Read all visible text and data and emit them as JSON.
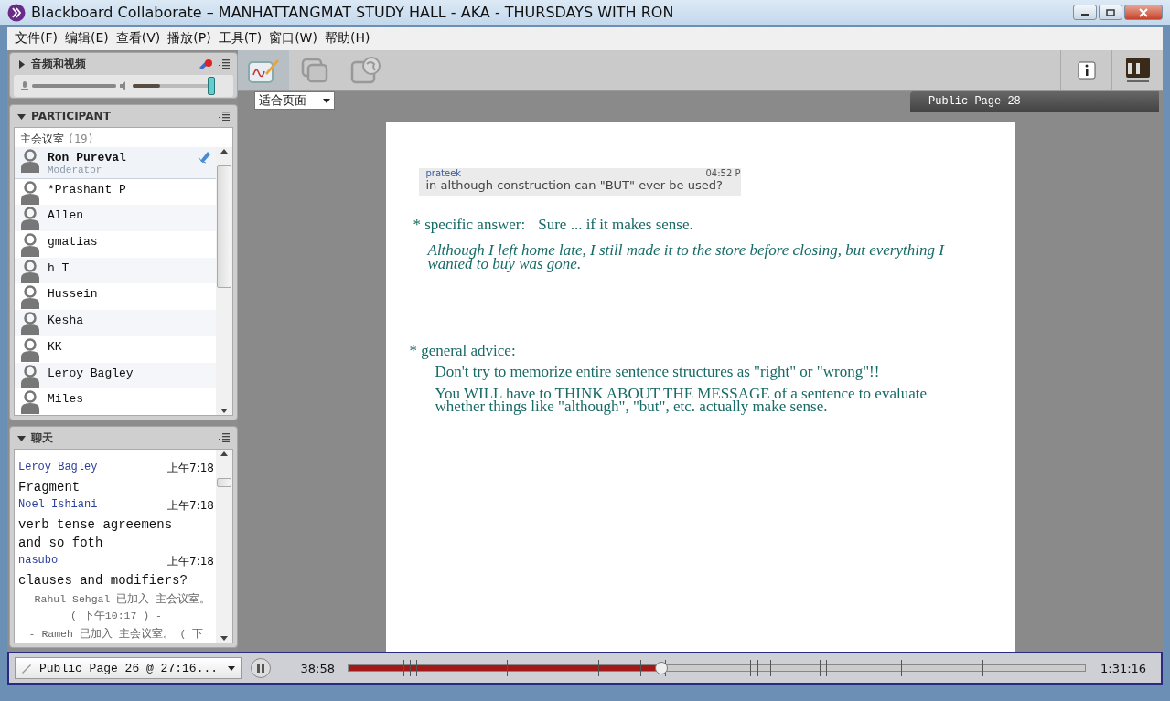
{
  "window": {
    "title": "Blackboard Collaborate – MANHATTANGMAT STUDY HALL - AKA - THURSDAYS WITH RON"
  },
  "menu": [
    "文件(F)",
    "编辑(E)",
    "查看(V)",
    "播放(P)",
    "工具(T)",
    "窗口(W)",
    "帮助(H)"
  ],
  "audio_panel": {
    "title": "音频和视频",
    "expanded": false,
    "microphone": {
      "level": 1
    },
    "speaker": {
      "level": 1
    }
  },
  "participant_panel": {
    "title": "PARTICIPANT",
    "expanded": true,
    "room": "主会议室",
    "count": "(19)",
    "participants": [
      {
        "name": "Ron Pureval",
        "role": "Moderator",
        "mic": true,
        "selected": true
      },
      {
        "name": "*Prashant P",
        "mic": false,
        "selected": false
      },
      {
        "name": "Allen",
        "mic": false,
        "selected": false
      },
      {
        "name": "gmatias",
        "mic": false,
        "selected": false
      },
      {
        "name": "h T",
        "mic": false,
        "selected": false
      },
      {
        "name": "Hussein",
        "mic": false,
        "selected": false
      },
      {
        "name": "Kesha",
        "mic": false,
        "selected": false
      },
      {
        "name": "KK",
        "mic": false,
        "selected": false
      },
      {
        "name": "Leroy Bagley",
        "mic": false,
        "selected": false
      },
      {
        "name": "Miles",
        "mic": false,
        "selected": false
      }
    ]
  },
  "chat_panel": {
    "title": "聊天",
    "expanded": true,
    "messages": [
      {
        "kind": "message",
        "author": "Leroy Bagley",
        "time": "上午7:18",
        "text": "Fragment"
      },
      {
        "kind": "message",
        "author": "Noel Ishiani",
        "time": "上午7:18",
        "text": "verb tense agreemens and so foth"
      },
      {
        "kind": "message",
        "author": "nasubo",
        "time": "上午7:18",
        "text": "clauses and modifiers?"
      },
      {
        "kind": "system",
        "text": "- Rahul Sehgal 已加入 主会议室。 ( 下午10:17 ) -"
      },
      {
        "kind": "system",
        "text": "- Rameh 已加入 主会议室。 ( 下"
      }
    ]
  },
  "toolbar": {
    "tools": [
      {
        "kind": "whiteboard",
        "selected": true
      },
      {
        "kind": "app-share",
        "selected": false
      },
      {
        "kind": "web-tour",
        "selected": false
      }
    ]
  },
  "zoom_select": {
    "value": "适合页面"
  },
  "page_tab": {
    "title": "Public Page 28"
  },
  "slide": {
    "quote": {
      "author": "prateek",
      "time": "04:52 P",
      "text": "in although construction can \"BUT\" ever be used?"
    },
    "answer_label": "* specific answer:",
    "answer": "Sure ... if it makes sense.",
    "example": "Although I left home late, I still made it to the store before closing, but everything I wanted to buy was gone.",
    "advice_label": "* general advice:",
    "advice": [
      "Don't try to memorize entire sentence structures as \"right\" or \"wrong\"!!",
      "You WILL have to THINK ABOUT THE MESSAGE of a sentence to evaluate whether things like \"although\", \"but\", etc. actually make sense."
    ]
  },
  "playback": {
    "recording_select": "Public Page 26 @ 27:16...",
    "elapsed": "38:58",
    "total": "1:31:16",
    "level": 0.425
  }
}
